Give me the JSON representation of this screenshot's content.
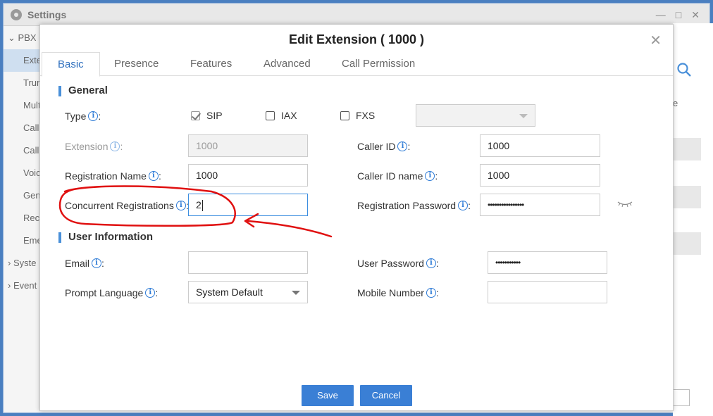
{
  "background": {
    "title": "Settings",
    "sidebar": {
      "parent": "PBX",
      "items": [
        "Exte",
        "Trun",
        "Mult",
        "Call",
        "Call",
        "Voic",
        "Gen",
        "Rec",
        "Eme"
      ],
      "groups": [
        "Syste",
        "Event"
      ]
    },
    "edge_text": "e"
  },
  "dialog": {
    "title": "Edit Extension ( 1000 )",
    "tabs": [
      "Basic",
      "Presence",
      "Features",
      "Advanced",
      "Call Permission"
    ],
    "active_tab": "Basic",
    "general": {
      "title": "General",
      "type_label": "Type",
      "type_options": [
        {
          "label": "SIP",
          "checked": true
        },
        {
          "label": "IAX",
          "checked": false
        },
        {
          "label": "FXS",
          "checked": false
        }
      ],
      "fxs_select_value": "",
      "extension_label": "Extension",
      "extension_value": "1000",
      "caller_id_label": "Caller ID",
      "caller_id_value": "1000",
      "registration_name_label": "Registration Name",
      "registration_name_value": "1000",
      "caller_id_name_label": "Caller ID name",
      "caller_id_name_value": "1000",
      "concurrent_registrations_label": "Concurrent Registrations",
      "concurrent_registrations_value": "2",
      "registration_password_label": "Registration Password",
      "registration_password_value": "••••••••••••••••"
    },
    "user_info": {
      "title": "User Information",
      "email_label": "Email",
      "email_value": "",
      "user_password_label": "User Password",
      "user_password_value": "•••••••••••",
      "prompt_language_label": "Prompt Language",
      "prompt_language_value": "System Default",
      "mobile_number_label": "Mobile Number",
      "mobile_number_value": ""
    },
    "buttons": {
      "save": "Save",
      "cancel": "Cancel"
    }
  },
  "colors": {
    "accent": "#3a7fd5",
    "info_icon": "#2e7bd6",
    "annotation": "#e01010"
  },
  "icons": [
    "gear-icon",
    "close-icon",
    "info-icon",
    "eye-hidden-icon",
    "search-icon",
    "chevron-down-icon"
  ]
}
